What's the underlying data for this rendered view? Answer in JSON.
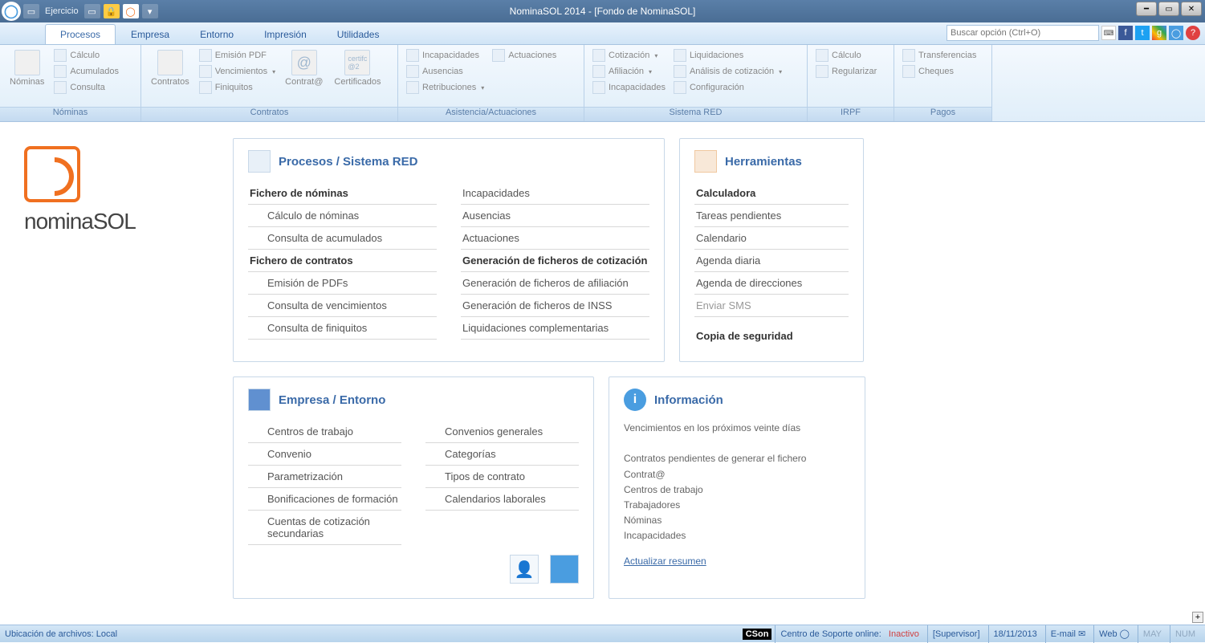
{
  "app": {
    "title": "NominaSOL 2014 - [Fondo de NominaSOL]",
    "qat_label": "Ejercicio"
  },
  "tabs": [
    "Procesos",
    "Empresa",
    "Entorno",
    "Impresión",
    "Utilidades"
  ],
  "search": {
    "placeholder": "Buscar opción (Ctrl+O)"
  },
  "ribbon": {
    "groups": [
      {
        "label": "Nóminas",
        "big": [
          {
            "label": "Nóminas"
          }
        ],
        "small": [
          [
            {
              "t": "Cálculo"
            },
            {
              "t": "Acumulados"
            },
            {
              "t": "Consulta"
            }
          ]
        ]
      },
      {
        "label": "Contratos",
        "big": [
          {
            "label": "Contratos"
          }
        ],
        "small": [
          [
            {
              "t": "Emisión PDF"
            },
            {
              "t": "Vencimientos",
              "dd": true
            },
            {
              "t": "Finiquitos"
            }
          ]
        ],
        "big2": [
          {
            "label": "Contrat@"
          },
          {
            "label": "Certificados"
          }
        ]
      },
      {
        "label": "Asistencia/Actuaciones",
        "small": [
          [
            {
              "t": "Incapacidades"
            },
            {
              "t": "Ausencias"
            },
            {
              "t": "Retribuciones",
              "dd": true
            }
          ],
          [
            {
              "t": "Actuaciones"
            }
          ]
        ]
      },
      {
        "label": "Sistema RED",
        "small": [
          [
            {
              "t": "Cotización",
              "dd": true
            },
            {
              "t": "Afiliación",
              "dd": true
            },
            {
              "t": "Incapacidades"
            }
          ],
          [
            {
              "t": "Liquidaciones"
            },
            {
              "t": "Análisis de cotización",
              "dd": true
            },
            {
              "t": "Configuración"
            }
          ]
        ]
      },
      {
        "label": "IRPF",
        "small": [
          [
            {
              "t": "Cálculo"
            },
            {
              "t": "Regularizar"
            }
          ]
        ]
      },
      {
        "label": "Pagos",
        "small": [
          [
            {
              "t": "Transferencias"
            },
            {
              "t": "Cheques"
            }
          ]
        ]
      }
    ]
  },
  "logo": {
    "name": "nomina",
    "suffix": "SOL"
  },
  "panels": {
    "procesos": {
      "title": "Procesos / Sistema RED",
      "col1": [
        {
          "t": "Fichero de nóminas",
          "b": true
        },
        {
          "t": "Cálculo de nóminas",
          "s": true
        },
        {
          "t": "Consulta de acumulados",
          "s": true
        },
        {
          "t": "Fichero de contratos",
          "b": true
        },
        {
          "t": "Emisión de PDFs",
          "s": true
        },
        {
          "t": "Consulta de vencimientos",
          "s": true
        },
        {
          "t": "Consulta de finiquitos",
          "s": true
        }
      ],
      "col2": [
        {
          "t": "Incapacidades"
        },
        {
          "t": "Ausencias"
        },
        {
          "t": "Actuaciones"
        },
        {
          "t": "Generación de ficheros de cotización",
          "b": true
        },
        {
          "t": "Generación de ficheros de afiliación"
        },
        {
          "t": "Generación de ficheros de INSS"
        },
        {
          "t": "Liquidaciones complementarias"
        }
      ]
    },
    "herramientas": {
      "title": "Herramientas",
      "items": [
        {
          "t": "Calculadora",
          "b": true
        },
        {
          "t": "Tareas pendientes"
        },
        {
          "t": "Calendario"
        },
        {
          "t": "Agenda diaria"
        },
        {
          "t": "Agenda de direcciones"
        },
        {
          "t": "Enviar SMS",
          "g": true
        },
        {
          "t": "Copia de seguridad",
          "b": true
        }
      ]
    },
    "empresa": {
      "title": "Empresa / Entorno",
      "col1": [
        {
          "t": "Centros de trabajo"
        },
        {
          "t": "Convenio"
        },
        {
          "t": "Parametrización"
        },
        {
          "t": "Bonificaciones de formación"
        },
        {
          "t": "Cuentas de cotización secundarias"
        }
      ],
      "col2": [
        {
          "t": "Convenios generales"
        },
        {
          "t": "Categorías"
        },
        {
          "t": "Tipos de contrato"
        },
        {
          "t": "Calendarios laborales"
        }
      ]
    },
    "info": {
      "title": "Información",
      "lines": [
        "Vencimientos en los próximos veinte días",
        "",
        "Contratos pendientes de generar el fichero Contrat@",
        "Centros de trabajo",
        "Trabajadores",
        "Nóminas",
        "Incapacidades"
      ],
      "link": "Actualizar resumen"
    }
  },
  "status": {
    "left": "Ubicación de archivos: Local",
    "cson": "CSon",
    "support_label": "Centro de Soporte online:",
    "support_status": "Inactivo",
    "user": "[Supervisor]",
    "date": "18/11/2013",
    "email": "E-mail",
    "web": "Web",
    "may": "MAY",
    "num": "NUM"
  }
}
